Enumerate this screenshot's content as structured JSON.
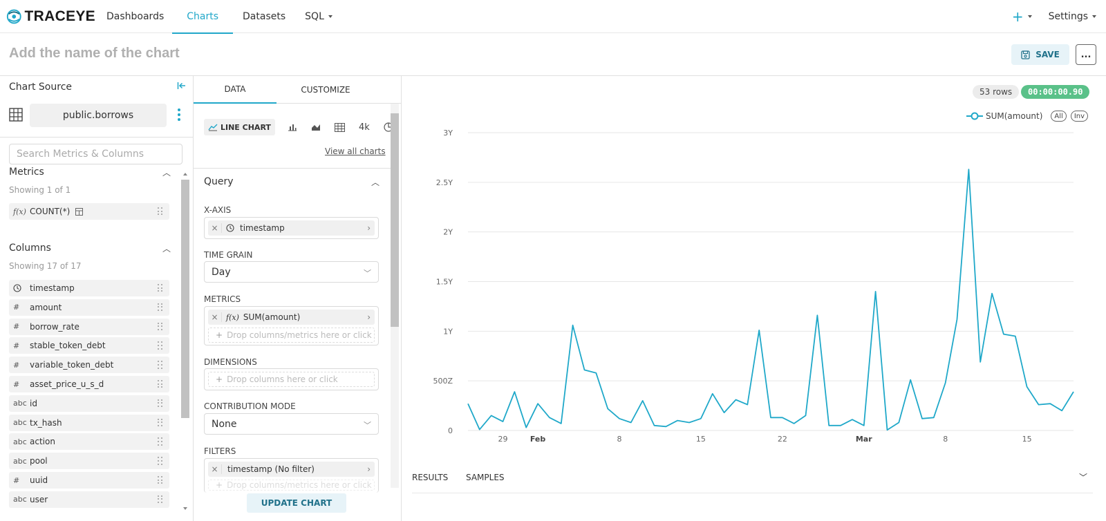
{
  "nav": {
    "logo": "TRACEYE",
    "items": [
      "Dashboards",
      "Charts",
      "Datasets",
      "SQL"
    ],
    "plus": "+",
    "settings": "Settings"
  },
  "header": {
    "chart_name_placeholder": "Add the name of the chart",
    "save_label": "SAVE",
    "more_label": "..."
  },
  "left": {
    "title": "Chart Source",
    "dataset": "public.borrows",
    "search_placeholder": "Search Metrics & Columns",
    "metrics_title": "Metrics",
    "metrics_showing": "Showing 1 of 1",
    "metrics": [
      {
        "type": "f(x)",
        "name": "COUNT(*)"
      }
    ],
    "columns_title": "Columns",
    "columns_showing": "Showing 17 of 17",
    "columns": [
      {
        "type": "clock",
        "name": "timestamp"
      },
      {
        "type": "#",
        "name": "amount"
      },
      {
        "type": "#",
        "name": "borrow_rate"
      },
      {
        "type": "#",
        "name": "stable_token_debt"
      },
      {
        "type": "#",
        "name": "variable_token_debt"
      },
      {
        "type": "#",
        "name": "asset_price_u_s_d"
      },
      {
        "type": "abc",
        "name": "id"
      },
      {
        "type": "abc",
        "name": "tx_hash"
      },
      {
        "type": "abc",
        "name": "action"
      },
      {
        "type": "abc",
        "name": "pool"
      },
      {
        "type": "#",
        "name": "uuid"
      },
      {
        "type": "abc",
        "name": "user"
      }
    ]
  },
  "middle": {
    "tab_data": "DATA",
    "tab_customize": "CUSTOMIZE",
    "viz_active": "LINE CHART",
    "viz_big_number": "4k",
    "view_all": "View all charts",
    "query_title": "Query",
    "x_axis_label": "X-AXIS",
    "x_axis_value": "timestamp",
    "time_grain_label": "TIME GRAIN",
    "time_grain_value": "Day",
    "metrics_label": "METRICS",
    "metrics_value": "SUM(amount)",
    "metrics_drop": "Drop columns/metrics here or click",
    "dimensions_label": "DIMENSIONS",
    "dimensions_drop": "Drop columns here or click",
    "contribution_label": "CONTRIBUTION MODE",
    "contribution_value": "None",
    "filters_label": "FILTERS",
    "filters_value": "timestamp (No filter)",
    "filters_drop": "Drop columns/metrics here or click",
    "update_label": "UPDATE CHART"
  },
  "chart": {
    "rows": "53 rows",
    "time": "00:00:00.90",
    "legend_series": "SUM(amount)",
    "legend_all": "All",
    "legend_inv": "Inv",
    "results_tab": "RESULTS",
    "samples_tab": "SAMPLES"
  },
  "colors": {
    "accent": "#20a7c9",
    "series": "#1fa8c9",
    "success": "#5ac189"
  },
  "chart_data": {
    "type": "line",
    "series": [
      {
        "name": "SUM(amount)",
        "values": [
          270,
          10,
          150,
          90,
          390,
          30,
          270,
          130,
          70,
          1060,
          610,
          580,
          220,
          120,
          80,
          300,
          50,
          40,
          100,
          80,
          120,
          370,
          180,
          310,
          260,
          1010,
          130,
          130,
          70,
          150,
          1160,
          50,
          50,
          110,
          50,
          1400,
          5,
          80,
          510,
          120,
          130,
          480,
          1120,
          2630,
          690,
          1380,
          970,
          950,
          440,
          260,
          270,
          200,
          390
        ]
      }
    ],
    "x_ticks": [
      "29",
      "Feb",
      "8",
      "15",
      "22",
      "Mar",
      "8",
      "15"
    ],
    "y_ticks": [
      "0",
      "500Z",
      "1Y",
      "1.5Y",
      "2Y",
      "2.5Y",
      "3Y"
    ],
    "ylim": [
      0,
      3000
    ],
    "grid": true,
    "legend": "top-right"
  }
}
